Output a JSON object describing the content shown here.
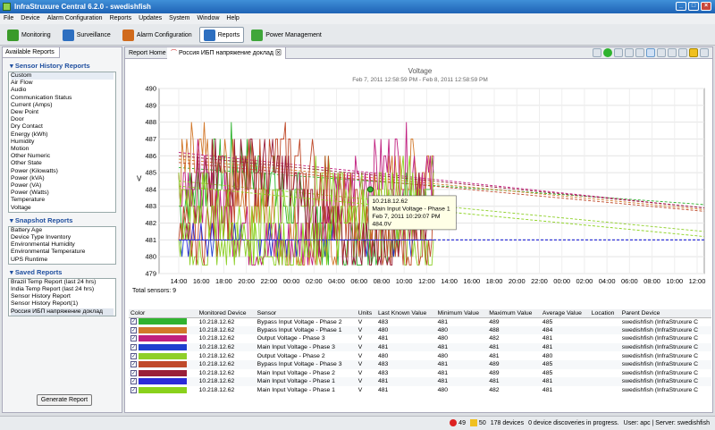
{
  "app": {
    "title": "InfraStruxure Central 6.2.0 - swedishfish"
  },
  "menu": [
    "File",
    "Device",
    "Alarm Configuration",
    "Reports",
    "Updates",
    "System",
    "Window",
    "Help"
  ],
  "toolbar": [
    {
      "label": "Monitoring",
      "color": "#3a9a2a"
    },
    {
      "label": "Surveillance",
      "color": "#2d6fc0"
    },
    {
      "label": "Alarm Configuration",
      "color": "#d06a1c"
    },
    {
      "label": "Reports",
      "color": "#2d6fc0",
      "selected": true
    },
    {
      "label": "Power Management",
      "color": "#3fa63a"
    }
  ],
  "left": {
    "tab": "Available Reports",
    "sensor_heading": "Sensor History Reports",
    "sensor_items": [
      "Custom",
      "Air Flow",
      "Audio",
      "Communication Status",
      "Current (Amps)",
      "Dew Point",
      "Door",
      "Dry Contact",
      "Energy (kWh)",
      "Humidity",
      "Motion",
      "Other Numeric",
      "Other State",
      "Power (Kilowatts)",
      "Power (kVA)",
      "Power (VA)",
      "Power (Watts)",
      "Temperature",
      "Voltage"
    ],
    "snapshot_heading": "Snapshot Reports",
    "snapshot_items": [
      "Battery Age",
      "Device Type Inventory",
      "Environmental Humidity",
      "Environmental Temperature",
      "UPS Runtime"
    ],
    "saved_heading": "Saved Reports",
    "saved_items": [
      "Brazil Temp Report (last 24 hrs)",
      "India Temp Report (last 24 hrs)",
      "Sensor History Report",
      "Sensor History Report(1)",
      "Россия ИБП напряжение доклад"
    ],
    "generate_button": "Generate Report"
  },
  "tabs": {
    "home": "Report Home",
    "active": "Россия ИБП напряжение доклад"
  },
  "chart_data": {
    "type": "line",
    "title": "Voltage",
    "subtitle": "Feb 7, 2011 12:58:59 PM - Feb 8, 2011 12:58:59 PM",
    "ylabel": "V",
    "ylim": [
      479,
      490
    ],
    "yticks": [
      479,
      480,
      481,
      482,
      483,
      484,
      485,
      486,
      487,
      488,
      489,
      490
    ],
    "xticks": [
      "14:00",
      "16:00",
      "18:00",
      "20:00",
      "22:00",
      "00:00",
      "02:00",
      "04:00",
      "06:00",
      "08:00",
      "10:00",
      "12:00",
      "14:00",
      "16:00",
      "18:00",
      "20:00",
      "22:00",
      "00:00",
      "02:00",
      "04:00",
      "06:00",
      "08:00",
      "10:00",
      "12:00"
    ],
    "total_sensors": "Total sensors: 9",
    "tooltip": [
      "10.218.12.62",
      "Main Input Voltage - Phase 1",
      "Feb 7, 2011 10:29:07 PM",
      "484.0V"
    ],
    "tooltip_point": {
      "x": 8.5,
      "y": 484
    },
    "series": [
      {
        "name": "Bypass Input Voltage - Phase 2",
        "color": "#2fb32f",
        "base": 483,
        "amp": 5,
        "trend": [
          485.3,
          483.1
        ]
      },
      {
        "name": "Bypass Input Voltage - Phase 1",
        "color": "#d2782a",
        "base": 483,
        "amp": 5,
        "trend": [
          485.8,
          482.8
        ]
      },
      {
        "name": "Output Voltage - Phase 3",
        "color": "#c01f7f",
        "base": 483,
        "amp": 5,
        "trend": [
          486.2,
          482.9
        ]
      },
      {
        "name": "Main Input Voltage - Phase 3",
        "color": "#1f3fcf",
        "base": 481,
        "amp": 0.6,
        "trend": [
          481,
          481
        ]
      },
      {
        "name": "Output Voltage - Phase 2",
        "color": "#8fd02a",
        "base": 482,
        "amp": 4,
        "trend": [
          484.5,
          481.5
        ]
      },
      {
        "name": "Bypass Input Voltage - Phase 3",
        "color": "#c04a2a",
        "base": 483,
        "amp": 5,
        "trend": [
          485.6,
          482.7
        ]
      },
      {
        "name": "Main Input Voltage - Phase 2",
        "color": "#9a1f3a",
        "base": 483,
        "amp": 5,
        "trend": [
          486,
          482.9
        ]
      },
      {
        "name": "Main Input Voltage - Phase 1",
        "color": "#2b2bd8",
        "base": 481,
        "amp": 0.6,
        "trend": [
          481,
          481
        ]
      },
      {
        "name": "Main Input Voltage - Phase 1",
        "color": "#8ad11c",
        "base": 482,
        "amp": 4,
        "trend": [
          484.2,
          481.2
        ]
      }
    ]
  },
  "table": {
    "headers": [
      "Color",
      "Monitored Device",
      "Sensor",
      "Units",
      "Last Known Value",
      "Minimum Value",
      "Maximum Value",
      "Average Value",
      "Location",
      "Parent Device"
    ],
    "rows": [
      {
        "color": "#2fb32f",
        "device": "10.218.12.62",
        "sensor": "Bypass Input Voltage - Phase 2",
        "units": "V",
        "last": "483",
        "min": "481",
        "max": "489",
        "avg": "485",
        "loc": "",
        "parent": "swedishfish (InfraStruxure C"
      },
      {
        "color": "#d2782a",
        "device": "10.218.12.62",
        "sensor": "Bypass Input Voltage - Phase 1",
        "units": "V",
        "last": "480",
        "min": "480",
        "max": "488",
        "avg": "484",
        "loc": "",
        "parent": "swedishfish (InfraStruxure C"
      },
      {
        "color": "#c01f7f",
        "device": "10.218.12.62",
        "sensor": "Output Voltage - Phase 3",
        "units": "V",
        "last": "481",
        "min": "480",
        "max": "482",
        "avg": "481",
        "loc": "",
        "parent": "swedishfish (InfraStruxure C"
      },
      {
        "color": "#1f3fcf",
        "device": "10.218.12.62",
        "sensor": "Main Input Voltage - Phase 3",
        "units": "V",
        "last": "481",
        "min": "481",
        "max": "481",
        "avg": "481",
        "loc": "",
        "parent": "swedishfish (InfraStruxure C"
      },
      {
        "color": "#8fd02a",
        "device": "10.218.12.62",
        "sensor": "Output Voltage - Phase 2",
        "units": "V",
        "last": "480",
        "min": "480",
        "max": "481",
        "avg": "480",
        "loc": "",
        "parent": "swedishfish (InfraStruxure C"
      },
      {
        "color": "#c04a2a",
        "device": "10.218.12.62",
        "sensor": "Bypass Input Voltage - Phase 3",
        "units": "V",
        "last": "483",
        "min": "481",
        "max": "489",
        "avg": "485",
        "loc": "",
        "parent": "swedishfish (InfraStruxure C"
      },
      {
        "color": "#9a1f3a",
        "device": "10.218.12.62",
        "sensor": "Main Input Voltage - Phase 2",
        "units": "V",
        "last": "483",
        "min": "481",
        "max": "489",
        "avg": "485",
        "loc": "",
        "parent": "swedishfish (InfraStruxure C"
      },
      {
        "color": "#2b2bd8",
        "device": "10.218.12.62",
        "sensor": "Main Input Voltage - Phase 1",
        "units": "V",
        "last": "481",
        "min": "481",
        "max": "481",
        "avg": "481",
        "loc": "",
        "parent": "swedishfish (InfraStruxure C"
      },
      {
        "color": "#8ad11c",
        "device": "10.218.12.62",
        "sensor": "Main Input Voltage - Phase 1",
        "units": "V",
        "last": "481",
        "min": "480",
        "max": "482",
        "avg": "481",
        "loc": "",
        "parent": "swedishfish (InfraStruxure C"
      }
    ]
  },
  "status": {
    "errors": "49",
    "warnings": "50",
    "devices": "178 devices",
    "discoveries": "0 device discoveries in progress.",
    "user": "User: apc | Server: swedishfish"
  }
}
